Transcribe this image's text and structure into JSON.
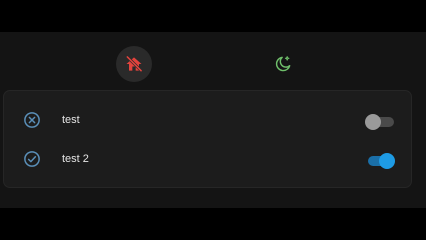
{
  "colors": {
    "away_icon": "#e2433d",
    "night_icon": "#6fbf6b",
    "row_icon": "#5a8fb8",
    "toggle_on": "#1e9be4",
    "toggle_off": "#9a9a9a"
  },
  "modes": [
    {
      "icon": "home-off-icon",
      "active": true
    },
    {
      "icon": "moon-star-icon",
      "active": false
    }
  ],
  "items": [
    {
      "label": "test",
      "icon": "close-circle-icon",
      "enabled": false
    },
    {
      "label": "test 2",
      "icon": "check-circle-icon",
      "enabled": true
    }
  ]
}
